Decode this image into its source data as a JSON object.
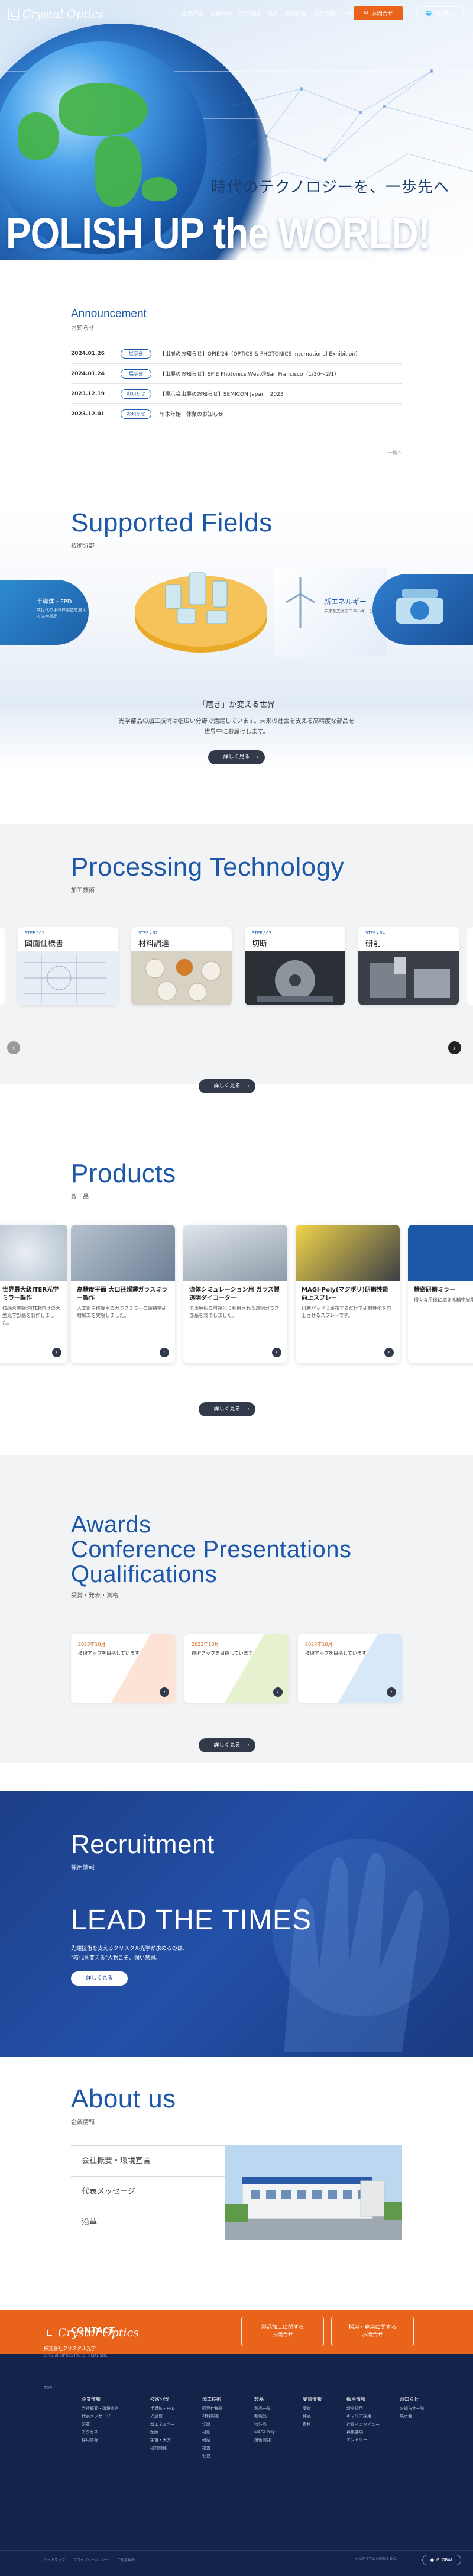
{
  "header": {
    "logo_text": "Crystal Optics",
    "nav": [
      "企業情報",
      "技術分野",
      "加工技術",
      "製品",
      "受賞情報",
      "採用情報",
      "お知らせ"
    ],
    "contact_label": "お問合せ",
    "global_label": "GLOBAL"
  },
  "hero": {
    "subtitle": "時代のテクノロジーを、一歩先へ",
    "title": "POLISH UP the WORLD!"
  },
  "announcement": {
    "title": "Announcement",
    "subtitle": "お知らせ",
    "items": [
      {
        "date": "2024.01.26",
        "badge": "展示会",
        "text": "【出展のお知らせ】OPIE'24（OPTICS & PHOTONICS International Exhibition）"
      },
      {
        "date": "2024.01.24",
        "badge": "展示会",
        "text": "【出展のお知らせ】SPIE Photonics West＠San Francisco（1/30〜2/1）"
      },
      {
        "date": "2023.12.19",
        "badge": "お知らせ",
        "text": "【展示会出展のお知らせ】SEMICON Japan　2023"
      },
      {
        "date": "2023.12.01",
        "badge": "お知らせ",
        "text": "年末年始　休業のお知らせ"
      }
    ],
    "list_link": "一覧へ"
  },
  "fields": {
    "title": "Supported Fields",
    "subtitle": "技術分野",
    "left_name": "半導体・FPD",
    "left_text": "次世代の半導体製造を支える光学部品",
    "right_name": "新エネルギー",
    "right_text": "未来を支えるエネルギー分野",
    "desc_title": "「磨き」が変える世界",
    "desc": "光学部品の加工技術は幅広い分野で活躍しています。未来の社会を支える高精度な部品を世界中にお届けします。",
    "more": "詳しく見る"
  },
  "processing": {
    "title": "Processing Technology",
    "subtitle": "加工技術",
    "steps": [
      {
        "num": "STEP / 01",
        "name": "図面仕様書"
      },
      {
        "num": "STEP / 02",
        "name": "材料調達"
      },
      {
        "num": "STEP / 03",
        "name": "切断"
      },
      {
        "num": "STEP / 04",
        "name": "研削"
      }
    ],
    "more": "詳しく見る"
  },
  "products": {
    "title": "Products",
    "subtitle": "製　品",
    "items": [
      {
        "title": "世界最大級ITER光学ミラー製作",
        "text": "核融合実験炉ITER向けの大型光学部品を製作しました。"
      },
      {
        "title": "高精度平面 大口径超薄ガラスミラー製作",
        "text": "人工衛星搭載用のガラスミラーの超精密研磨加工を実現しました。"
      },
      {
        "title": "流体シミュレーション用 ガラス製透明ダイコーター",
        "text": "流体解析の可視化に利用される透明ガラス部品を製作しました。"
      },
      {
        "title": "MAGI-Poly(マジポリ)研磨性能向上スプレー",
        "text": "研磨パッドに塗布するだけで研磨性能を向上させるスプレーです。"
      },
      {
        "title": "精密研磨ミラー",
        "text": "様々な用途に応える精密光学部品。"
      }
    ],
    "more": "詳しく見る"
  },
  "awards": {
    "title_lines": [
      "Awards",
      "Conference Presentations",
      "Qualifications"
    ],
    "subtitle": "受賞・発表・資格",
    "items": [
      {
        "date": "2023年10月",
        "text": "技術アップを目指しています"
      },
      {
        "date": "2023年10月",
        "text": "技術アップを目指しています"
      },
      {
        "date": "2023年10月",
        "text": "技術アップを目指しています"
      }
    ],
    "more": "詳しく見る"
  },
  "recruit": {
    "title": "Recruitment",
    "subtitle": "採用情報",
    "catch": "LEAD THE TIMES",
    "text1": "先端技術を支えるクリスタル光学が求めるのは、",
    "text2": "\"時代を変える\"人物こそ、強い意思。",
    "more": "詳しく見る"
  },
  "about": {
    "title": "About us",
    "subtitle": "企業情報",
    "rows": [
      "会社概要・環境宣言",
      "代表メッセージ",
      "沿革"
    ],
    "building_sign": "Crystal Optics Inc."
  },
  "contact": {
    "label": "CONTACT",
    "btn1": "製品加工に関する\nお問合せ",
    "btn2": "採用・雇用に関する\nお問合せ"
  },
  "footer": {
    "logo_text": "Crystal Optics",
    "company": "株式会社クリスタル光学",
    "company_en": "CRYSTAL OPTICS INC. OFFICIAL SITE",
    "cols": [
      {
        "head": "企業情報",
        "items": [
          "会社概要・環境宣言",
          "代表メッセージ",
          "沿革",
          "アクセス",
          "採用情報"
        ]
      },
      {
        "head": "技術分野",
        "items": [
          "半導体・FPD",
          "光通信",
          "新エネルギー",
          "医療",
          "宇宙・天文",
          "研究開発"
        ]
      },
      {
        "head": "加工技術",
        "items": [
          "図面仕様書",
          "材料調達",
          "切断",
          "研削",
          "研磨",
          "検査",
          "梱包"
        ]
      },
      {
        "head": "製品",
        "items": [
          "製品一覧",
          "新製品",
          "特注品",
          "MAGI-Poly",
          "技術開発"
        ]
      },
      {
        "head": "受賞情報",
        "items": [
          "受賞",
          "発表",
          "資格"
        ]
      },
      {
        "head": "採用情報",
        "items": [
          "新卒採用",
          "キャリア採用",
          "社員インタビュー",
          "募集要項",
          "エントリー"
        ]
      },
      {
        "head": "お知らせ",
        "items": [
          "お知らせ一覧",
          "展示会"
        ]
      }
    ],
    "links": [
      "サイトマップ",
      "プライバシーポリシー",
      "ご利用規約"
    ],
    "copyright": "© CRYSTAL OPTICS INC.",
    "global": "GLOBAL"
  },
  "colors": {
    "accent": "#1d57a8",
    "orange": "#e9631a",
    "dark": "#13234a"
  }
}
